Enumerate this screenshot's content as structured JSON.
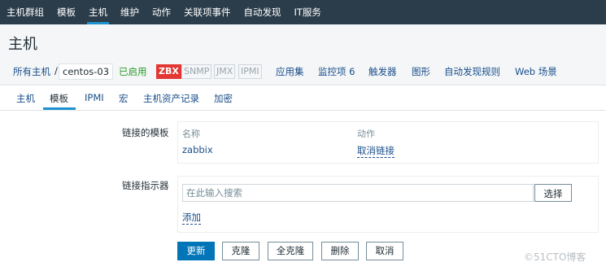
{
  "topnav": [
    "主机群组",
    "模板",
    "主机",
    "维护",
    "动作",
    "关联项事件",
    "自动发现",
    "IT服务"
  ],
  "page_title": "主机",
  "breadcrumb": {
    "all_hosts": "所有主机",
    "separator": "/",
    "current": "centos-03",
    "status": "已启用",
    "tags": [
      "ZBX",
      "SNMP",
      "JMX",
      "IPMI"
    ],
    "links": [
      "应用集",
      "监控项 6",
      "触发器",
      "图形",
      "自动发现规则",
      "Web 场景"
    ]
  },
  "tabs": [
    "主机",
    "模板",
    "IPMI",
    "宏",
    "主机资产记录",
    "加密"
  ],
  "linked_templates": {
    "label": "链接的模板",
    "col_name": "名称",
    "col_action": "动作",
    "rows": [
      {
        "name": "zabbix",
        "action": "取消链接"
      }
    ]
  },
  "link_indicator": {
    "label": "链接指示器",
    "placeholder": "在此输入搜索",
    "select_label": "选择",
    "add_label": "添加"
  },
  "buttons": {
    "update": "更新",
    "clone": "克隆",
    "full_clone": "全克隆",
    "delete": "删除",
    "cancel": "取消"
  },
  "watermark": "©51CTO博客",
  "colors": {
    "nav_bg": "#2b3c4a",
    "accent": "#1f91d0",
    "link": "#1a4e8a",
    "enabled": "#2b9b29",
    "zbx_tag": "#e33734",
    "primary_button": "#0275b8"
  }
}
